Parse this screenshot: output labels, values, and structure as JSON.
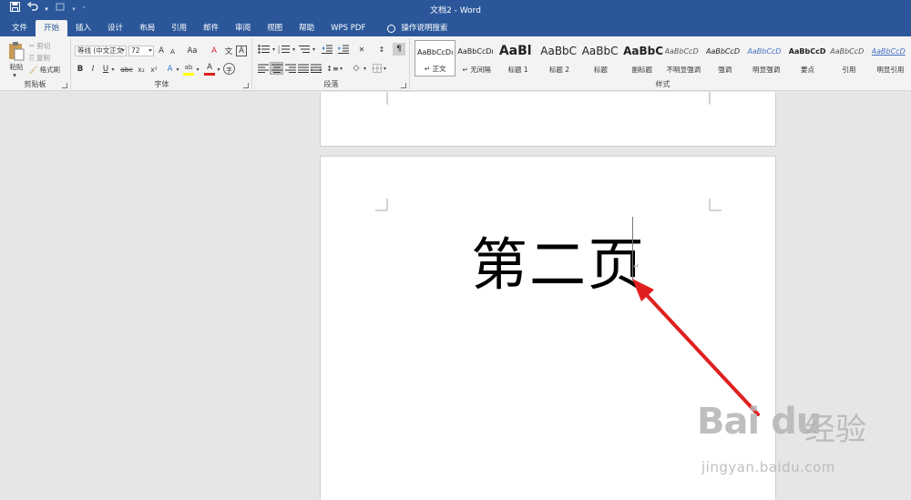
{
  "window": {
    "title": "文档2 - Word"
  },
  "qat": {
    "save_icon": "save-icon",
    "undo_icon": "undo-icon",
    "redo_icon": "redo-icon",
    "customize_icon": "customize-icon"
  },
  "tabs": [
    {
      "label": "文件"
    },
    {
      "label": "开始"
    },
    {
      "label": "插入"
    },
    {
      "label": "设计"
    },
    {
      "label": "布局"
    },
    {
      "label": "引用"
    },
    {
      "label": "邮件"
    },
    {
      "label": "审阅"
    },
    {
      "label": "视图"
    },
    {
      "label": "帮助"
    },
    {
      "label": "WPS PDF"
    }
  ],
  "tell_me": {
    "label": "操作说明搜索"
  },
  "clipboard": {
    "paste": "粘贴",
    "cut": "剪切",
    "copy": "复制",
    "format_painter": "格式刷",
    "group": "剪贴板"
  },
  "font": {
    "name": "等线 (中文正文",
    "size": "72",
    "group": "字体",
    "bold": "B",
    "italic": "I",
    "underline": "U",
    "strike": "abc",
    "sub": "x₂",
    "sup": "x²",
    "grow": "A",
    "shrink": "A",
    "case": "Aa",
    "clear": "A",
    "phonetic": "文",
    "border_char": "A",
    "effects": "A",
    "highlight": "ab",
    "color": "A",
    "encircle": "字"
  },
  "paragraph": {
    "group": "段落"
  },
  "styles": {
    "group": "样式",
    "items": [
      {
        "sample": "AaBbCcDı",
        "name": "↵ 正文"
      },
      {
        "sample": "AaBbCcDı",
        "name": "↵ 无间隔"
      },
      {
        "sample": "AaBl",
        "name": "标题 1"
      },
      {
        "sample": "AaBbC",
        "name": "标题 2"
      },
      {
        "sample": "AaBbC",
        "name": "标题"
      },
      {
        "sample": "AaBbC",
        "name": "副标题"
      },
      {
        "sample": "AaBbCcD",
        "name": "不明显强调"
      },
      {
        "sample": "AaBbCcD",
        "name": "强调"
      },
      {
        "sample": "AaBbCcD",
        "name": "明显强调"
      },
      {
        "sample": "AaBbCcD",
        "name": "要点"
      },
      {
        "sample": "AaBbCcD",
        "name": "引用"
      },
      {
        "sample": "AaBbCcD",
        "name": "明显引用"
      }
    ]
  },
  "document": {
    "page2_text": "第二页"
  },
  "watermark": {
    "logo": "Bai du",
    "cn": "经验",
    "url": "jingyan.baidu.com"
  },
  "colors": {
    "titlebar": "#2b579a",
    "ribbon": "#f3f3f3",
    "arrow": "#e02020",
    "font_color_bar": "#e02020",
    "highlight_bar": "#ffff00"
  }
}
